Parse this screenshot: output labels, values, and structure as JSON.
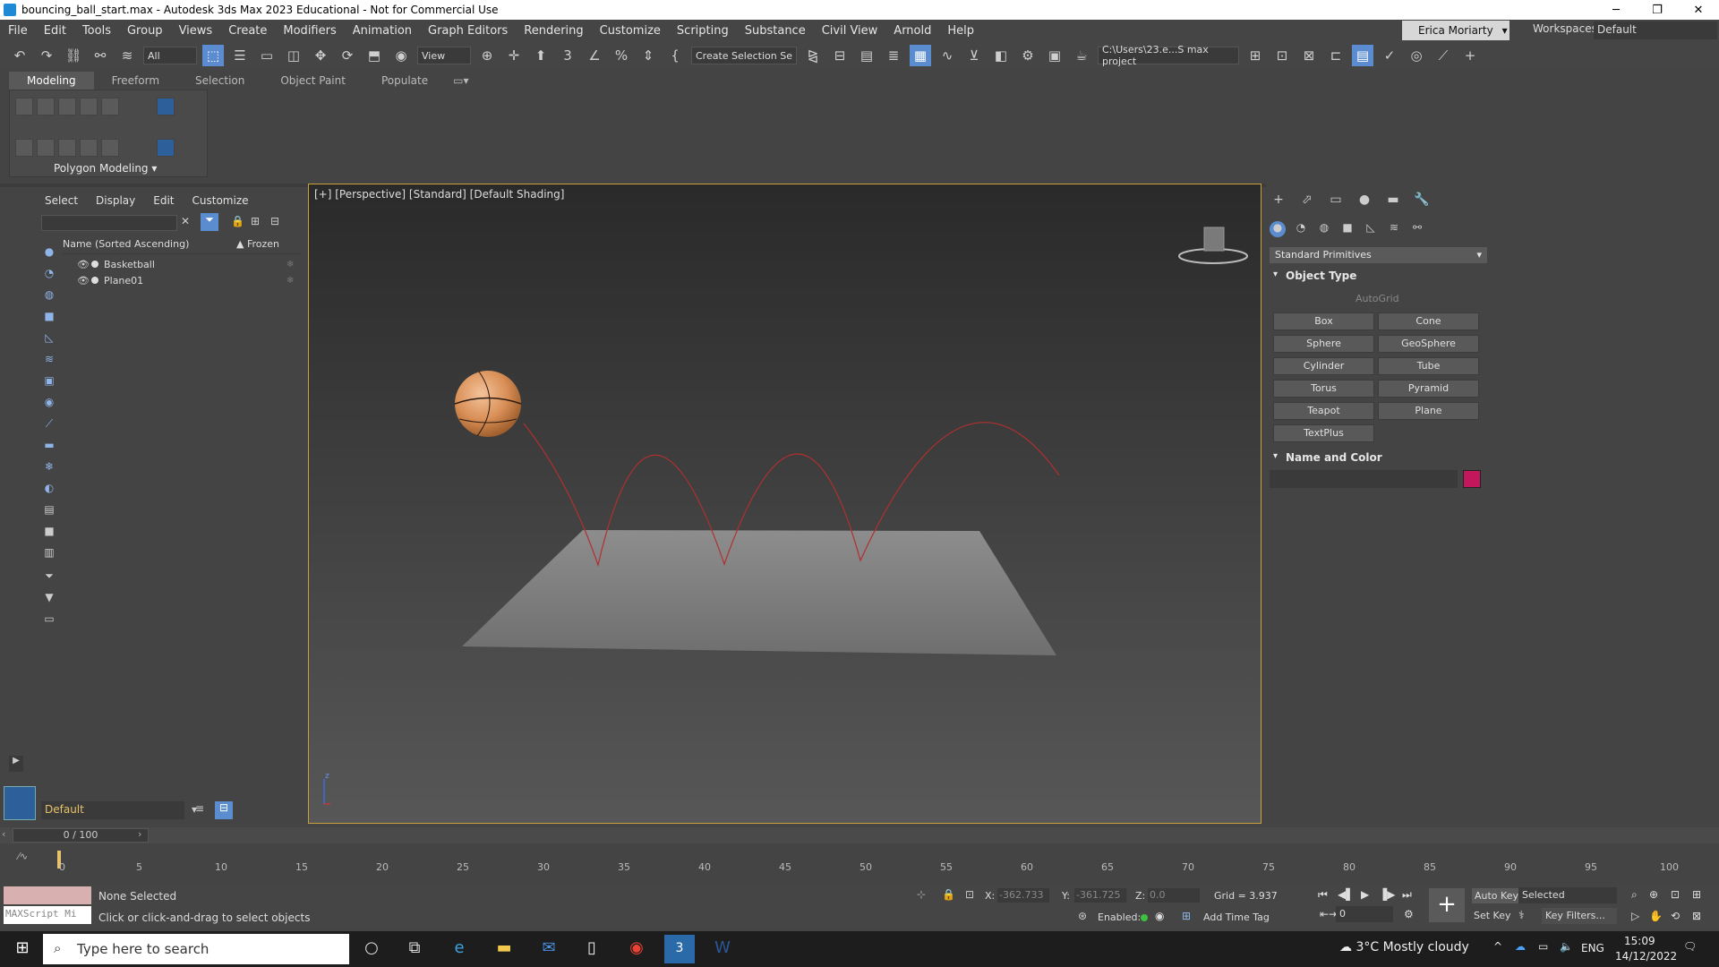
{
  "window": {
    "title": "bouncing_ball_start.max - Autodesk 3ds Max 2023 Educational - Not for Commercial Use",
    "minimize_icon": "minimize-icon",
    "restore_icon": "restore-icon",
    "close_icon": "close-icon"
  },
  "menu": [
    "File",
    "Edit",
    "Tools",
    "Group",
    "Views",
    "Create",
    "Modifiers",
    "Animation",
    "Graph Editors",
    "Rendering",
    "Customize",
    "Scripting",
    "Substance",
    "Civil View",
    "Arnold",
    "Help"
  ],
  "user": {
    "name": "Erica Moriarty",
    "workspaces_label": "Workspaces:",
    "workspace_value": "Default"
  },
  "toolbar": {
    "filter_value": "All",
    "view_value": "View",
    "selection_set_value": "Create Selection Se",
    "project_path": "C:\\Users\\23.e...S max project"
  },
  "ribbon": {
    "tabs": [
      "Modeling",
      "Freeform",
      "Selection",
      "Object Paint",
      "Populate"
    ],
    "panel_label": "Polygon Modeling"
  },
  "scene_explorer": {
    "menu": [
      "Select",
      "Display",
      "Edit",
      "Customize"
    ],
    "header_name": "Name (Sorted Ascending)",
    "header_frozen": "▲ Frozen",
    "rows": [
      "Basketball",
      "Plane01"
    ],
    "layer_value": "Default"
  },
  "viewport": {
    "label": "[+] [Perspective] [Standard] [Default Shading]",
    "axis_z": "z"
  },
  "command_panel": {
    "category_value": "Standard Primitives",
    "object_type_label": "Object Type",
    "autogrid_label": "AutoGrid",
    "buttons": [
      "Box",
      "Cone",
      "Sphere",
      "GeoSphere",
      "Cylinder",
      "Tube",
      "Torus",
      "Pyramid",
      "Teapot",
      "Plane",
      "TextPlus"
    ],
    "name_color_label": "Name and Color",
    "object_color": "#c2185b"
  },
  "timeline": {
    "frame_display": "0 / 100",
    "ticks": [
      "0",
      "5",
      "10",
      "15",
      "20",
      "25",
      "30",
      "35",
      "40",
      "45",
      "50",
      "55",
      "60",
      "65",
      "70",
      "75",
      "80",
      "85",
      "90",
      "95",
      "100"
    ]
  },
  "status": {
    "maxscript_placeholder": "MAXScript Mi",
    "selection_text": "None Selected",
    "prompt_text": "Click or click-and-drag to select objects",
    "x_label": "X:",
    "x_value": "-362.733",
    "y_label": "Y:",
    "y_value": "-361.725",
    "z_label": "Z:",
    "z_value": "0.0",
    "grid_text": "Grid = 3.937",
    "enabled_label": "Enabled:",
    "add_time_tag": "Add Time Tag",
    "auto_key": "Auto Key",
    "set_key": "Set Key",
    "selected_value": "Selected",
    "key_filters": "Key Filters...",
    "frame_value": "0"
  },
  "taskbar": {
    "search_placeholder": "Type here to search",
    "weather": "3°C  Mostly cloudy",
    "lang": "ENG",
    "time": "15:09",
    "date": "14/12/2022"
  }
}
